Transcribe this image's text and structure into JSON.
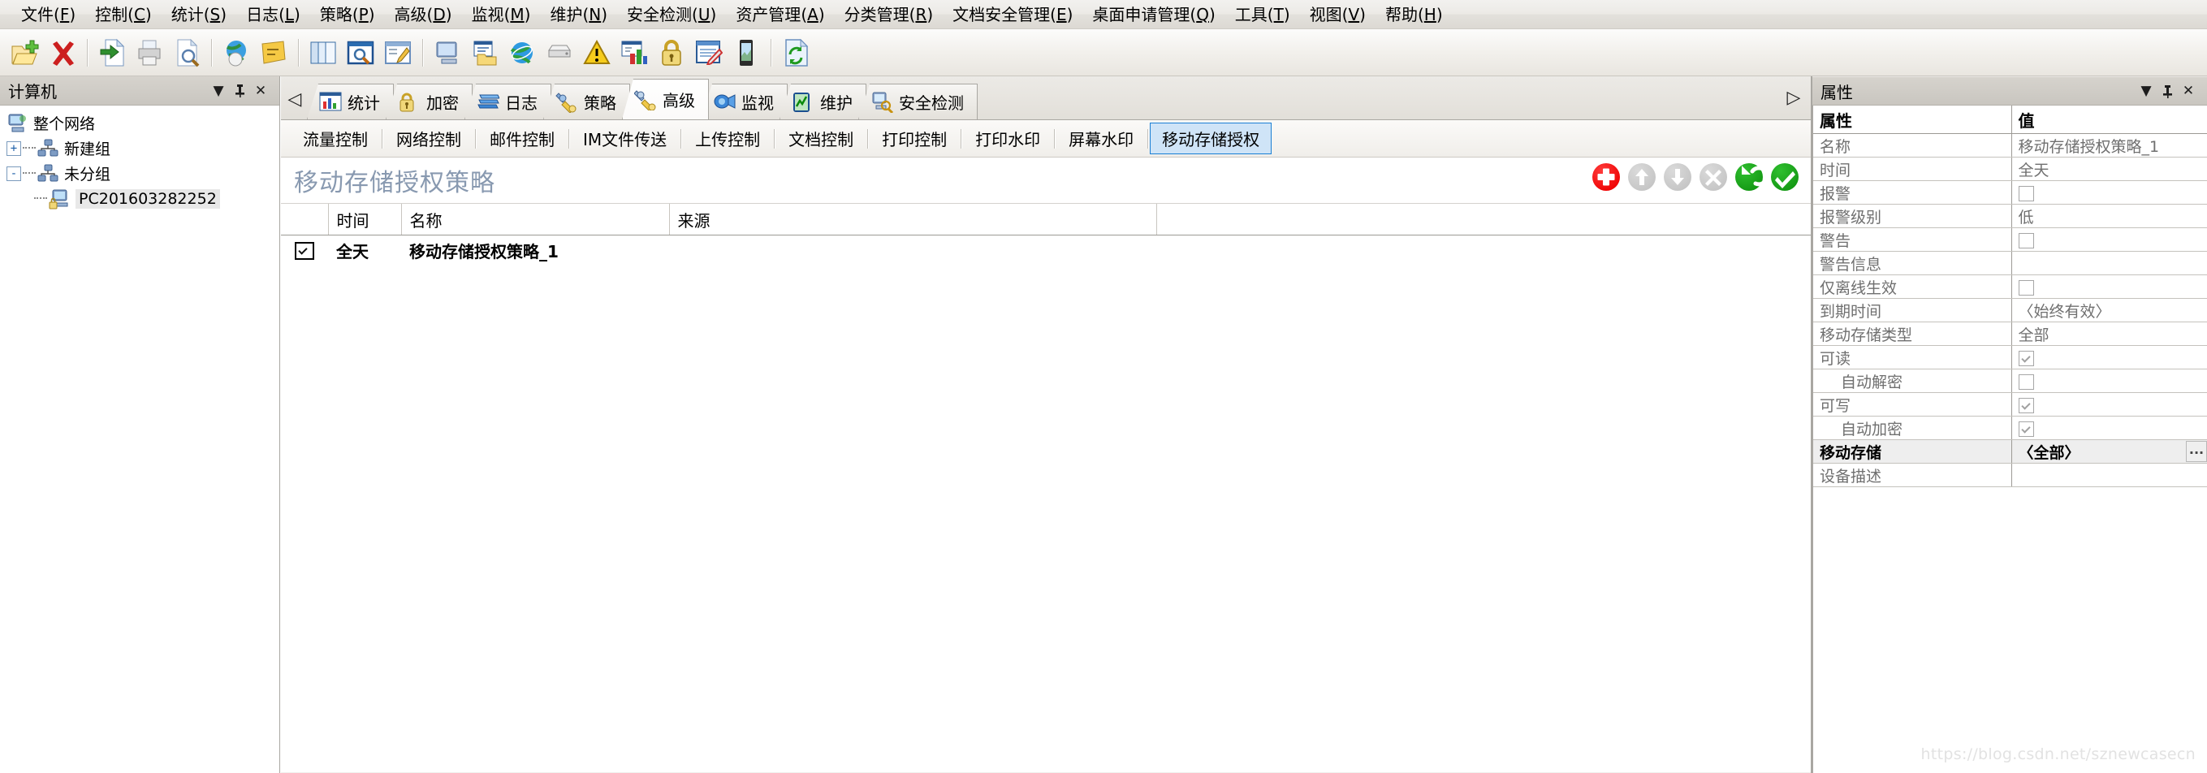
{
  "menubar": {
    "items": [
      {
        "label": "文件",
        "mnemonic": "F"
      },
      {
        "label": "控制",
        "mnemonic": "C"
      },
      {
        "label": "统计",
        "mnemonic": "S"
      },
      {
        "label": "日志",
        "mnemonic": "L"
      },
      {
        "label": "策略",
        "mnemonic": "P"
      },
      {
        "label": "高级",
        "mnemonic": "D"
      },
      {
        "label": "监视",
        "mnemonic": "M"
      },
      {
        "label": "维护",
        "mnemonic": "N"
      },
      {
        "label": "安全检测",
        "mnemonic": "U"
      },
      {
        "label": "资产管理",
        "mnemonic": "A"
      },
      {
        "label": "分类管理",
        "mnemonic": "R"
      },
      {
        "label": "文档安全管理",
        "mnemonic": "E"
      },
      {
        "label": "桌面申请管理",
        "mnemonic": "Q"
      },
      {
        "label": "工具",
        "mnemonic": "T"
      },
      {
        "label": "视图",
        "mnemonic": "V"
      },
      {
        "label": "帮助",
        "mnemonic": "H"
      }
    ]
  },
  "toolbar": {
    "icons": [
      "new-folder-icon",
      "delete-x-icon",
      "sep",
      "export-document-icon",
      "print-icon",
      "print-preview-icon",
      "sep",
      "globe-mouse-icon",
      "note-icon",
      "sep",
      "copy-documents-icon",
      "search-window-icon",
      "edit-window-icon",
      "sep",
      "computer-icon",
      "folder-report-icon",
      "internet-icon",
      "device-icon",
      "warning-icon",
      "chart-report-icon",
      "lock-icon",
      "notepad-edit-icon",
      "mobile-device-icon",
      "sep",
      "refresh-icon"
    ]
  },
  "left_panel": {
    "title": "计算机",
    "controls": [
      "dropdown-caret",
      "pin",
      "close"
    ],
    "tree": {
      "root": {
        "label": "整个网络",
        "icon": "network-root-icon"
      },
      "children": [
        {
          "label": "新建组",
          "icon": "group-icon",
          "expander": "+",
          "expanded": false
        },
        {
          "label": "未分组",
          "icon": "group-icon",
          "expander": "-",
          "expanded": true,
          "children": [
            {
              "label": "PC201603282252",
              "icon": "computer-locked-icon",
              "selected": true
            }
          ]
        }
      ]
    }
  },
  "main": {
    "tab_scroll_left": "◁",
    "tab_scroll_right": "▷",
    "tabs": [
      {
        "label": "统计",
        "icon": "chart-icon",
        "active": false
      },
      {
        "label": "加密",
        "icon": "lock-icon",
        "active": false
      },
      {
        "label": "日志",
        "icon": "logs-icon",
        "active": false
      },
      {
        "label": "策略",
        "icon": "policy-wrench-icon",
        "active": false
      },
      {
        "label": "高级",
        "icon": "advanced-tools-icon",
        "active": true
      },
      {
        "label": "监视",
        "icon": "monitor-camera-icon",
        "active": false
      },
      {
        "label": "维护",
        "icon": "maintain-icon",
        "active": false
      },
      {
        "label": "安全检测",
        "icon": "security-scan-icon",
        "active": false
      }
    ],
    "subtabs": [
      {
        "label": "流量控制",
        "active": false
      },
      {
        "label": "网络控制",
        "active": false
      },
      {
        "label": "邮件控制",
        "active": false
      },
      {
        "label": "IM文件传送",
        "active": false
      },
      {
        "label": "上传控制",
        "active": false
      },
      {
        "label": "文档控制",
        "active": false
      },
      {
        "label": "打印控制",
        "active": false
      },
      {
        "label": "打印水印",
        "active": false
      },
      {
        "label": "屏幕水印",
        "active": false
      },
      {
        "label": "移动存储授权",
        "active": true
      }
    ],
    "content": {
      "title": "移动存储授权策略",
      "actions": [
        {
          "name": "add-button",
          "glyph": "+",
          "color": "#ee0000",
          "enabled": true
        },
        {
          "name": "move-up-button",
          "glyph": "↑",
          "color": "#c4c4c4",
          "enabled": false
        },
        {
          "name": "move-down-button",
          "glyph": "↓",
          "color": "#c4c4c4",
          "enabled": false
        },
        {
          "name": "delete-button",
          "glyph": "✕",
          "color": "#c4c4c4",
          "enabled": false
        },
        {
          "name": "undo-button",
          "glyph": "↺",
          "color": "#129612",
          "enabled": true
        },
        {
          "name": "apply-button",
          "glyph": "✔",
          "color": "#129612",
          "enabled": true
        }
      ],
      "table": {
        "columns": [
          "",
          "时间",
          "名称",
          "来源"
        ],
        "rows": [
          {
            "checked": true,
            "time": "全天",
            "name": "移动存储授权策略_1",
            "source": ""
          }
        ]
      }
    }
  },
  "right_panel": {
    "title": "属性",
    "controls": [
      "dropdown-caret",
      "pin",
      "close"
    ],
    "columns": [
      "属性",
      "值"
    ],
    "rows": [
      {
        "key": "名称",
        "value": "移动存储授权策略_1",
        "type": "text",
        "indent": false,
        "selected": false
      },
      {
        "key": "时间",
        "value": "全天",
        "type": "text",
        "indent": false,
        "selected": false
      },
      {
        "key": "报警",
        "value": "",
        "type": "checkbox",
        "checked": false,
        "indent": false,
        "selected": false
      },
      {
        "key": "报警级别",
        "value": "低",
        "type": "text",
        "indent": false,
        "selected": false
      },
      {
        "key": "警告",
        "value": "",
        "type": "checkbox",
        "checked": false,
        "indent": false,
        "selected": false
      },
      {
        "key": "警告信息",
        "value": "",
        "type": "text",
        "indent": false,
        "selected": false
      },
      {
        "key": "仅离线生效",
        "value": "",
        "type": "checkbox",
        "checked": false,
        "indent": false,
        "selected": false
      },
      {
        "key": "到期时间",
        "value": "〈始终有效〉",
        "type": "text",
        "indent": false,
        "selected": false
      },
      {
        "key": "移动存储类型",
        "value": "全部",
        "type": "text",
        "indent": false,
        "selected": false
      },
      {
        "key": "可读",
        "value": "",
        "type": "checkbox",
        "checked": true,
        "indent": false,
        "selected": false
      },
      {
        "key": "自动解密",
        "value": "",
        "type": "checkbox",
        "checked": false,
        "indent": true,
        "selected": false
      },
      {
        "key": "可写",
        "value": "",
        "type": "checkbox",
        "checked": true,
        "indent": false,
        "selected": false
      },
      {
        "key": "自动加密",
        "value": "",
        "type": "checkbox",
        "checked": true,
        "indent": true,
        "selected": false
      },
      {
        "key": "移动存储",
        "value": "〈全部〉",
        "type": "picker",
        "button": "...",
        "indent": false,
        "selected": true
      },
      {
        "key": "设备描述",
        "value": "",
        "type": "text",
        "indent": false,
        "selected": false
      }
    ]
  },
  "watermark": "https://blog.csdn.net/sznewcasecn"
}
